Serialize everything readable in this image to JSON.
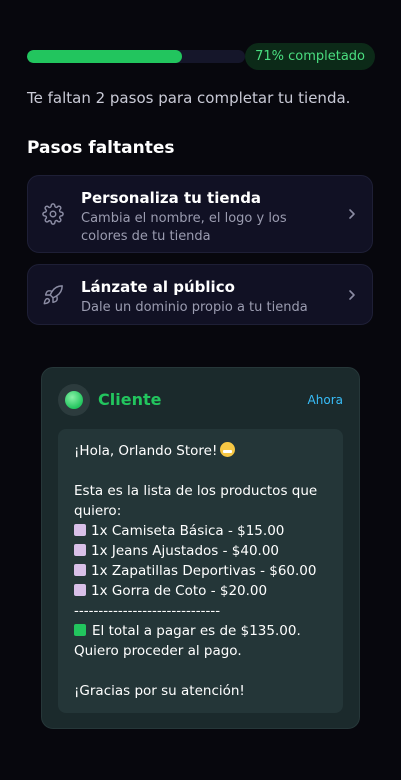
{
  "progress": {
    "value": 0.71,
    "label": "71% completado"
  },
  "subtitle": "Te faltan 2 pasos para completar tu tienda.",
  "section_title": "Pasos faltantes",
  "steps": [
    {
      "title": "Personaliza tu tienda",
      "description": "Cambia el nombre, el logo y los colores de tu tienda",
      "icon": "gear-icon"
    },
    {
      "title": "Lánzate al público",
      "description": "Dale un dominio propio a tu tienda",
      "icon": "rocket-icon"
    }
  ],
  "chat": {
    "sender": "Cliente",
    "time": "Ahora",
    "greeting": "¡Hola, Orlando Store!",
    "intro_1": "Esta es la lista de los productos que",
    "intro_2": "quiero:",
    "items": [
      "1x Camiseta Básica - $15.00",
      "1x Jeans Ajustados - $40.00",
      "1x Zapatillas Deportivas - $60.00",
      "1x Gorra de Coto - $20.00"
    ],
    "divider": "------------------------------",
    "total": "El total a pagar es de $135.00.",
    "proceed": "Quiero proceder al pago.",
    "thanks": "¡Gracias por su atención!"
  },
  "colors": {
    "accent": "#22c55e",
    "time": "#38bdf8",
    "background": "#07070d"
  }
}
